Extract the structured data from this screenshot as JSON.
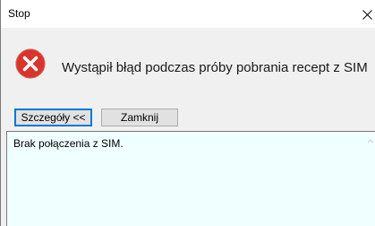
{
  "window": {
    "title": "Stop",
    "close_glyph": "✕"
  },
  "dialog": {
    "icon": "error-icon",
    "message": "Wystąpił błąd podczas próby pobrania recept z SIM"
  },
  "buttons": {
    "details_label": "Szczegóły <<",
    "close_label": "Zamknij"
  },
  "details": {
    "text": "Brak połączenia z SIM."
  },
  "colors": {
    "error_red": "#d9352b",
    "focus_blue": "#0078d7",
    "details_bg": "#f0ffff"
  }
}
